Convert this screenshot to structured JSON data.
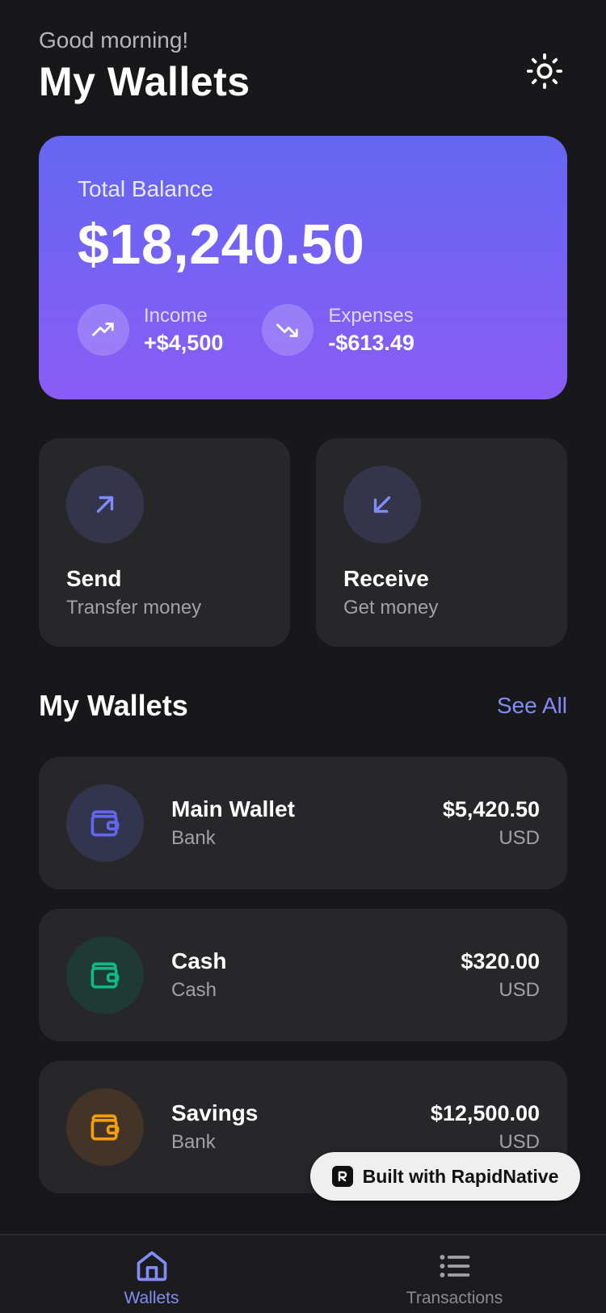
{
  "header": {
    "greeting": "Good morning!",
    "title": "My Wallets",
    "theme_icon": "sun-icon"
  },
  "balance": {
    "label": "Total Balance",
    "value": "$18,240.50",
    "income_label": "Income",
    "income_value": "+$4,500",
    "expenses_label": "Expenses",
    "expenses_value": "-$613.49",
    "gradient_start": "#6467f2",
    "gradient_end": "#8a5cf6"
  },
  "actions": [
    {
      "title": "Send",
      "subtitle": "Transfer money",
      "icon": "arrow-up-right-icon"
    },
    {
      "title": "Receive",
      "subtitle": "Get money",
      "icon": "arrow-down-left-icon"
    }
  ],
  "wallets_section": {
    "title": "My Wallets",
    "see_all": "See All"
  },
  "wallets": [
    {
      "name": "Main Wallet",
      "type": "Bank",
      "balance": "$5,420.50",
      "currency": "USD",
      "color": "#6366f1",
      "icon": "wallet-icon"
    },
    {
      "name": "Cash",
      "type": "Cash",
      "balance": "$320.00",
      "currency": "USD",
      "color": "#10b981",
      "icon": "wallet-icon"
    },
    {
      "name": "Savings",
      "type": "Bank",
      "balance": "$12,500.00",
      "currency": "USD",
      "color": "#f59e0b",
      "icon": "wallet-icon"
    }
  ],
  "badge": {
    "text": "Built with RapidNative"
  },
  "tabbar": {
    "tabs": [
      {
        "label": "Wallets",
        "icon": "home-icon",
        "active": true
      },
      {
        "label": "Transactions",
        "icon": "list-icon",
        "active": false
      }
    ]
  },
  "colors": {
    "accent": "#818cf8",
    "background": "#18181b",
    "card": "#27272a"
  }
}
